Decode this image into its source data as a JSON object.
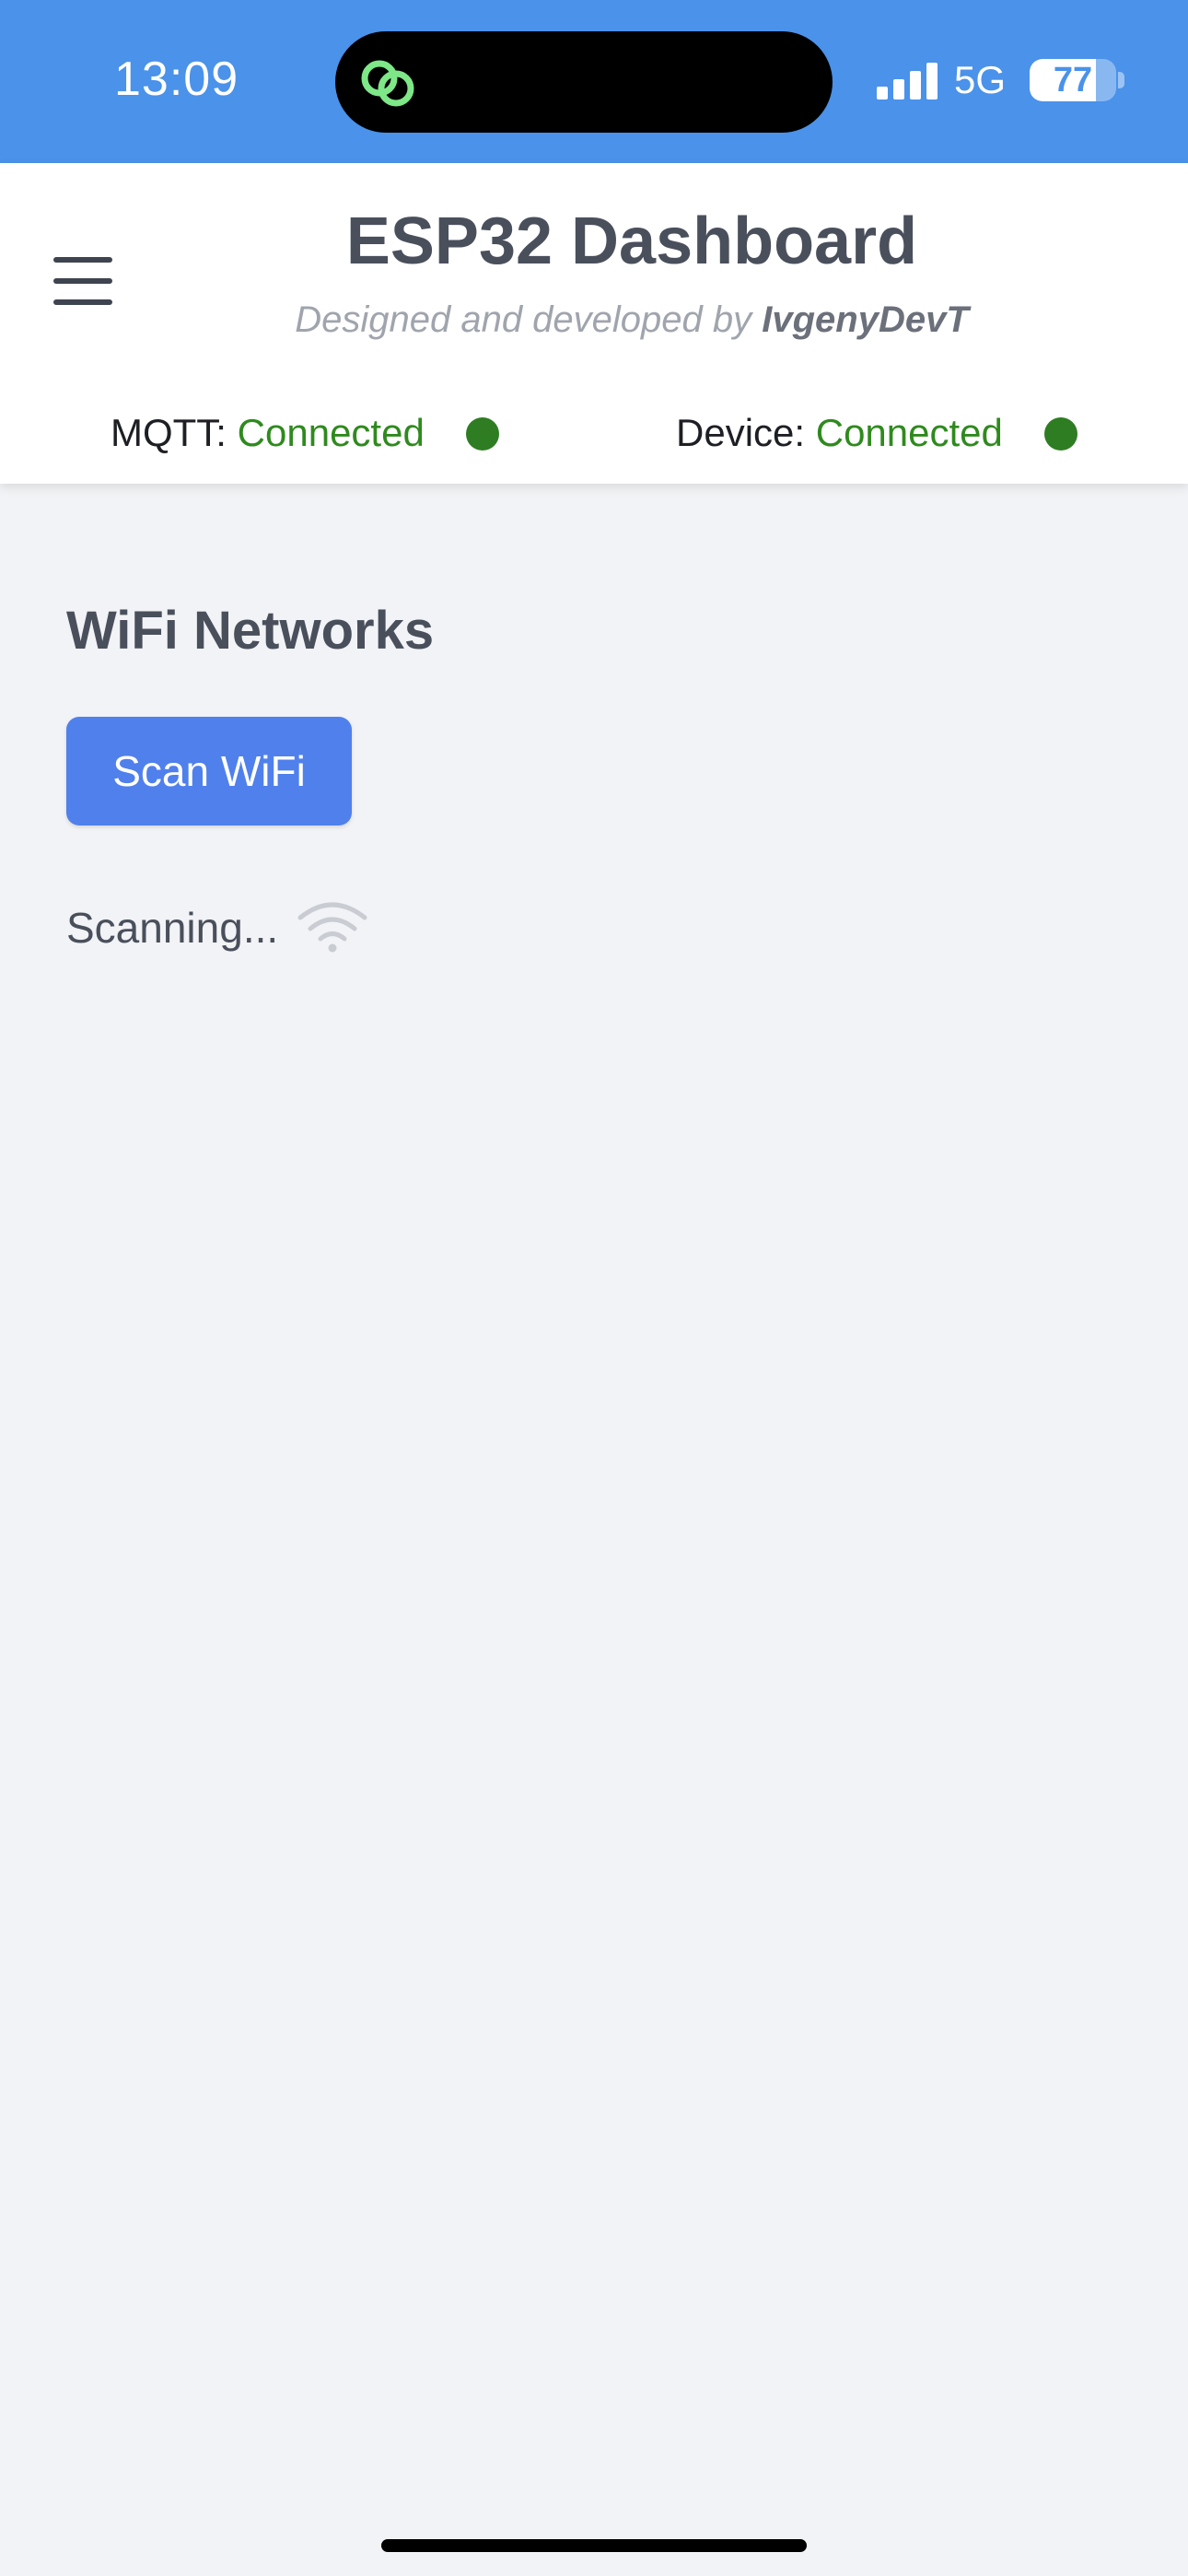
{
  "status_bar": {
    "time": "13:09",
    "network": "5G",
    "battery_percent": 77,
    "battery_label": "77",
    "background_color": "#4a92ea",
    "island_icon": "linked-circles-icon"
  },
  "header": {
    "title": "ESP32 Dashboard",
    "subtitle_prefix": "Designed and developed by ",
    "subtitle_author": "IvgenyDevT",
    "menu_icon": "hamburger-menu-icon"
  },
  "connection": {
    "mqtt_label": "MQTT:",
    "mqtt_status": "Connected",
    "device_label": "Device:",
    "device_status": "Connected",
    "status_color": "#2f8a1e",
    "dot_color": "#2e7d22"
  },
  "main": {
    "section_title": "WiFi Networks",
    "scan_button_label": "Scan WiFi",
    "scan_button_color": "#4f80ec",
    "scanning_text": "Scanning...",
    "scanning_icon": "wifi-icon"
  }
}
